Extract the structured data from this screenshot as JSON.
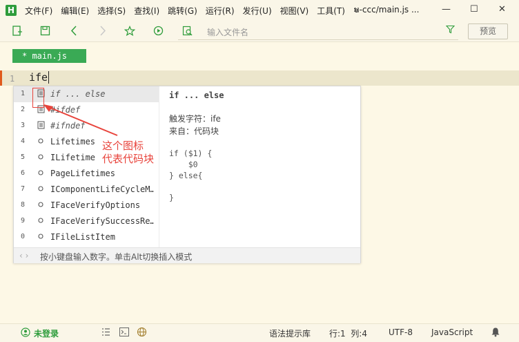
{
  "app": {
    "logo_letter": "H",
    "window_title": "u-ccc/main.js ..."
  },
  "menu": [
    "文件(F)",
    "编辑(E)",
    "选择(S)",
    "查找(I)",
    "跳转(G)",
    "运行(R)",
    "发行(U)",
    "视图(V)",
    "工具(T)",
    "»"
  ],
  "window_controls": {
    "minimize": "—",
    "maximize": "☐",
    "close": "✕"
  },
  "toolbar": {
    "search_placeholder": "输入文件名",
    "preview_label": "预览",
    "icons": [
      "new-file-icon",
      "save-icon",
      "back-icon",
      "forward-icon",
      "star-icon",
      "run-icon",
      "search-file-icon"
    ]
  },
  "tab": {
    "label": "* main.js"
  },
  "editor": {
    "line_number": "1",
    "code": "ife"
  },
  "suggestions": [
    {
      "num": "1",
      "icon": "snippet-icon",
      "label": "if ... else",
      "italic": true
    },
    {
      "num": "2",
      "icon": "snippet-icon",
      "label": "#ifdef",
      "italic": true
    },
    {
      "num": "3",
      "icon": "snippet-icon",
      "label": "#ifndef",
      "italic": true
    },
    {
      "num": "4",
      "icon": "circle-icon",
      "label": "Lifetimes",
      "italic": false
    },
    {
      "num": "5",
      "icon": "circle-icon",
      "label": "ILifetime",
      "italic": false
    },
    {
      "num": "6",
      "icon": "circle-icon",
      "label": "PageLifetimes",
      "italic": false
    },
    {
      "num": "7",
      "icon": "circle-icon",
      "label": "IComponentLifeCycleM…",
      "italic": false
    },
    {
      "num": "8",
      "icon": "circle-icon",
      "label": "IFaceVerifyOptions",
      "italic": false
    },
    {
      "num": "9",
      "icon": "circle-icon",
      "label": "IFaceVerifySuccessRe…",
      "italic": false
    },
    {
      "num": "0",
      "icon": "circle-icon",
      "label": "IFileListItem",
      "italic": false
    }
  ],
  "detail": {
    "title": "if ... else",
    "trigger": "触发字符：ife",
    "source": "来自：代码块",
    "code": "if ($1) {\n    $0\n} else{\n\n}"
  },
  "popup_footer": {
    "arrows": "‹ ›",
    "hint": "按小键盘输入数字。单击Alt切换插入模式"
  },
  "annotation": {
    "line1": "这个图标",
    "line2": "代表代码块",
    "color": "#e8433b"
  },
  "status": {
    "login": "未登录",
    "syntax_lib": "语法提示库",
    "position": "行:1  列:4",
    "encoding": "UTF-8",
    "language": "JavaScript"
  }
}
